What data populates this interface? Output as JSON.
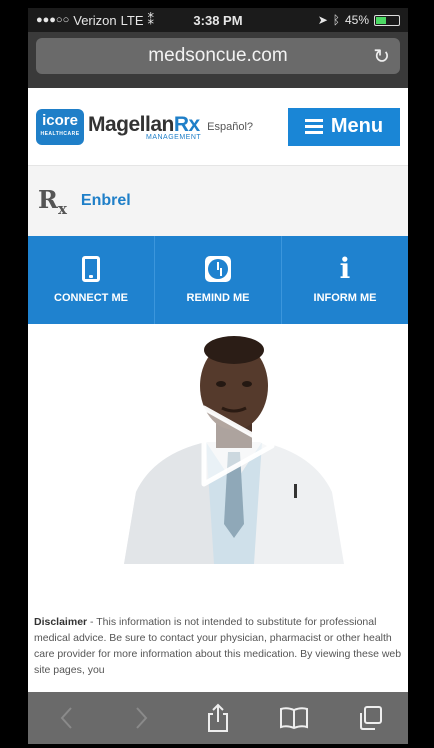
{
  "status_bar": {
    "signal": "●●●○○",
    "carrier": "Verizon",
    "network": "LTE",
    "time": "3:38 PM",
    "battery": "45%",
    "battery_level": 0.45
  },
  "url_bar": {
    "url": "medsoncue.com"
  },
  "header": {
    "icore_label": "icore",
    "icore_sub": "HEALTHCARE",
    "magellan_label": "Magellan",
    "magellan_rx": "Rx",
    "magellan_sub": "MANAGEMENT",
    "espanol_link": "Español?",
    "menu_label": "Menu"
  },
  "drug": {
    "rx_symbol": "R",
    "rx_sub": "x",
    "name": "Enbrel"
  },
  "actions": [
    {
      "label": "CONNECT ME",
      "icon": "phone-icon"
    },
    {
      "label": "REMIND ME",
      "icon": "clock-icon"
    },
    {
      "label": "INFORM ME",
      "icon": "info-icon"
    }
  ],
  "disclaimer": {
    "label": "Disclaimer",
    "text": " - This information is not intended to substitute for professional medical advice. Be sure to contact your physician, pharmacist or other health care provider for more information about this medication. By viewing these web site pages, you"
  },
  "colors": {
    "accent": "#1f82cf",
    "menu": "#1a86d6"
  }
}
